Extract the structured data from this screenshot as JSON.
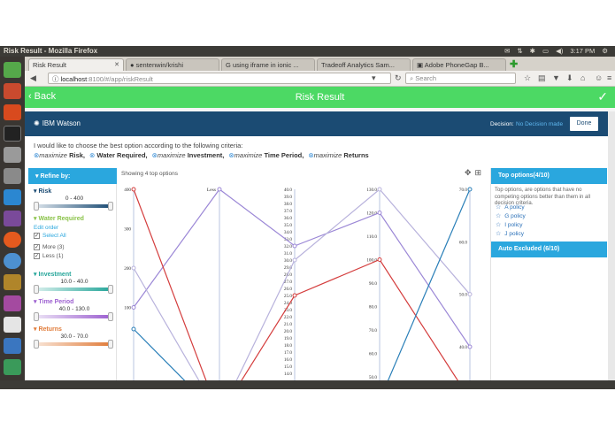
{
  "os": {
    "window_title": "Risk Result - Mozilla Firefox",
    "time": "3:17 PM"
  },
  "browser": {
    "tabs": [
      {
        "label": "Risk Result",
        "active": true
      },
      {
        "label": "sentenwin/krishi",
        "active": false
      },
      {
        "label": "using iframe in ionic ...",
        "active": false
      },
      {
        "label": "Tradeoff Analytics Sam...",
        "active": false
      },
      {
        "label": "Adobe PhoneGap B...",
        "active": false
      }
    ],
    "url_host": "localhost",
    "url_path": ":8100/#/app/riskResult",
    "search_placeholder": "Search"
  },
  "app": {
    "back_label": "Back",
    "title": "Risk Result"
  },
  "watson": {
    "logo_text": "IBM Watson",
    "decision_label": "Decision:",
    "decision_value": "No Decision made",
    "done_label": "Done"
  },
  "criteria": {
    "question": "I would like to choose the best option according to the following criteria:",
    "verb": "maximize",
    "items": [
      "Risk,",
      "Water Required,",
      "Investment,",
      "Time Period,",
      "Returns"
    ]
  },
  "refine": {
    "header": "Refine by:",
    "risk": {
      "label": "Risk",
      "range": "0 - 400",
      "color": "#1b4b73"
    },
    "water": {
      "label": "Water Required",
      "edit_order": "Edit order",
      "select_all": "Select All",
      "options": [
        "More (3)",
        "Less (1)"
      ],
      "color": "#8bc34a"
    },
    "investment": {
      "label": "Investment",
      "range": "10.0 - 40.0",
      "color": "#26a69a"
    },
    "time_period": {
      "label": "Time Period",
      "range": "40.0 - 130.0",
      "color": "#9c5fd0"
    },
    "returns": {
      "label": "Returns",
      "range": "30.0 - 70.0",
      "color": "#e07b39"
    }
  },
  "chart": {
    "showing": "Showing 4 top options",
    "tool_icons": [
      "move-icon",
      "pin-icon"
    ]
  },
  "chart_data": {
    "type": "parallel-coordinates",
    "axes": [
      {
        "name": "Risk",
        "ticks": [
          "400",
          "300",
          "200",
          "100"
        ],
        "min": 0,
        "max": 400
      },
      {
        "name": "Water Required",
        "ticks": [
          "Less"
        ],
        "categories": [
          "Less",
          "More"
        ]
      },
      {
        "name": "Investment",
        "ticks": [
          "40.0",
          "39.0",
          "38.0",
          "37.0",
          "36.0",
          "35.0",
          "34.0",
          "33.0",
          "32.0",
          "31.0",
          "30.0",
          "29.0",
          "28.0",
          "27.0",
          "26.0",
          "25.0",
          "24.0",
          "23.0",
          "22.0",
          "21.0",
          "20.0",
          "19.0",
          "18.0",
          "17.0",
          "16.0",
          "15.0",
          "14.0",
          "13.0"
        ],
        "min": 13,
        "max": 40
      },
      {
        "name": "Time Period",
        "ticks": [
          "130.0",
          "120.0",
          "110.0",
          "100.0",
          "90.0",
          "80.0",
          "70.0",
          "60.0",
          "50.0"
        ],
        "min": 50,
        "max": 130
      },
      {
        "name": "Returns",
        "ticks": [
          "70.0",
          "60.0",
          "50.0",
          "40.0"
        ],
        "min": 40,
        "max": 70
      }
    ],
    "series": [
      {
        "name": "A policy",
        "color": "#9b87d6",
        "values": [
          100,
          "Less",
          32,
          120,
          40
        ]
      },
      {
        "name": "G policy",
        "color": "#d43d3d",
        "values": [
          400,
          "More",
          25,
          100,
          30
        ]
      },
      {
        "name": "I policy",
        "color": "#b8b2dc",
        "values": [
          200,
          "More",
          30,
          130,
          50
        ]
      },
      {
        "name": "J policy",
        "color": "#2a7fb8",
        "values": [
          45,
          "More",
          10,
          40,
          70
        ]
      }
    ]
  },
  "top_options": {
    "header": "Top options(4/10)",
    "description": "Top options, are options that have no competing options better than them in all decision criteria.",
    "items": [
      "A policy",
      "G policy",
      "I policy",
      "J policy"
    ]
  },
  "auto_excluded": {
    "label": "Auto Excluded (6/10)"
  }
}
